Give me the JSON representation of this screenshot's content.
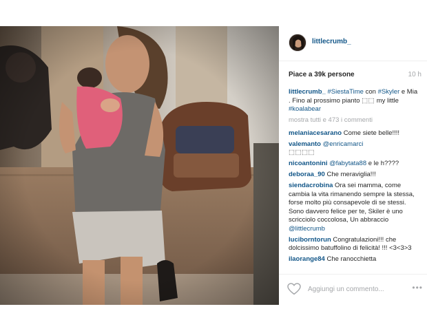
{
  "post": {
    "username": "littlecrumb_",
    "likes": "Piace a 39k persone",
    "time": "10 h",
    "caption": {
      "user": "littlecrumb_",
      "tag1": "#SiestaTime",
      "text1": " con ",
      "tag2": "#Skyler",
      "text2": " e Mia . Fino al prossimo pianto ",
      "emoji": "⬚⬚",
      "text3": " my little ",
      "tag3": "#koalabear"
    },
    "more_comments": "mostra tutti e 473 i commenti",
    "comments": [
      {
        "user": "melaniacesarano",
        "text": " Come siete belle!!!!"
      },
      {
        "user": "valemanto",
        "mention": " @enricamarci",
        "text": "⬚⬚⬚⬚"
      },
      {
        "user": "nicoantonini",
        "mention": " @fabytata88",
        "text": " e le h????"
      },
      {
        "user": "deboraa_90",
        "text": " Che meraviglia!!!"
      },
      {
        "user": "siendacrobina",
        "text": " Ora sei mamma, come cambia la vita rimanendo sempre la stessa, forse molto più consapevole di se stessi. Sono davvero felice per te, Skiler è uno scricciolo coccolosa, Un abbraccio ",
        "mention": "@littlecrumb"
      },
      {
        "user": "luciborntorun",
        "text": " Congratulazioni!!! che dolcissimo batuffolino di felicità! !!! <3<3>3"
      },
      {
        "user": "ilaorange84",
        "text": " Che ranocchietta"
      }
    ],
    "add_comment_placeholder": "Aggiungi un commento...",
    "more_options": "•••"
  },
  "icons": {
    "heart": "heart-icon",
    "avatar": "avatar"
  },
  "colors": {
    "username": "#125688",
    "muted": "#a5a7aa",
    "text": "#262626"
  }
}
